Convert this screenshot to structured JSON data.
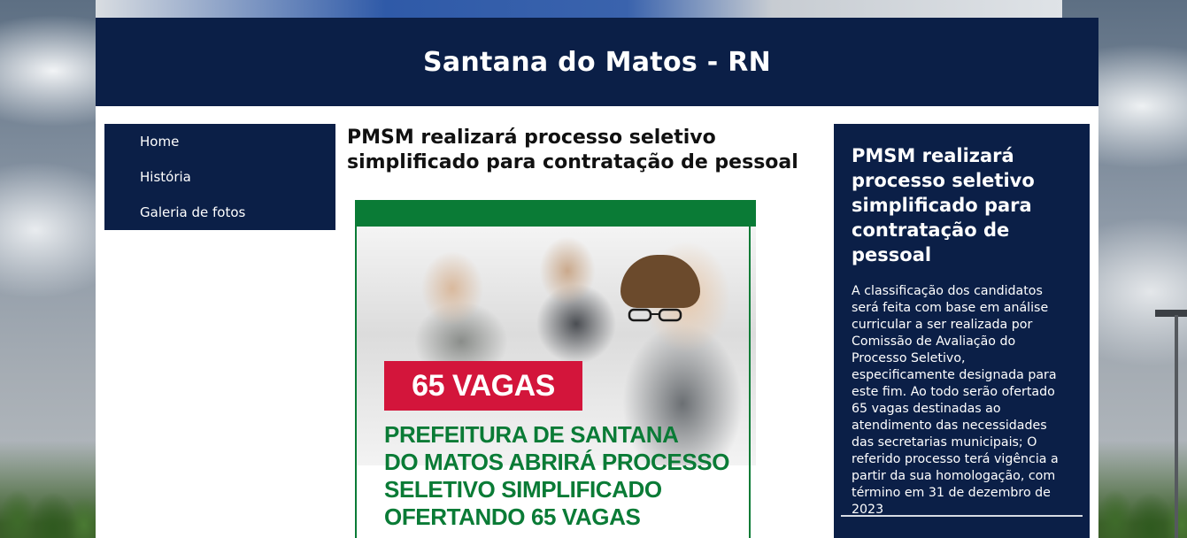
{
  "site": {
    "title": "Santana do Matos - RN"
  },
  "nav": {
    "items": [
      {
        "label": "Home"
      },
      {
        "label": "História"
      },
      {
        "label": "Galeria de fotos"
      }
    ]
  },
  "article": {
    "title": "PMSM realizará processo seletivo simplificado para contratação de pessoal",
    "image": {
      "badge": "65 VAGAS",
      "headline_lines": [
        "PREFEITURA DE SANTANA",
        "DO MATOS ABRIRÁ PROCESSO",
        "SELETIVO SIMPLIFICADO",
        "OFERTANDO 65 VAGAS"
      ],
      "colors": {
        "green": "#0a7b36",
        "red": "#d3153b"
      }
    }
  },
  "sidebar": {
    "title": "PMSM realizará processo seletivo simplificado para contratação de pessoal",
    "text": "A classificação dos candidatos será feita com base em análise curricular a ser realizada por Comissão de Avaliação do Processo Seletivo, especificamente designada para este fim. Ao todo serão ofertado 65 vagas destinadas ao atendimento das necessidades das secretarias municipais; O referido processo terá vigência a partir da sua homologação, com término em 31 de dezembro de 2023"
  },
  "theme": {
    "navy": "#0b1f47",
    "white": "#ffffff"
  }
}
